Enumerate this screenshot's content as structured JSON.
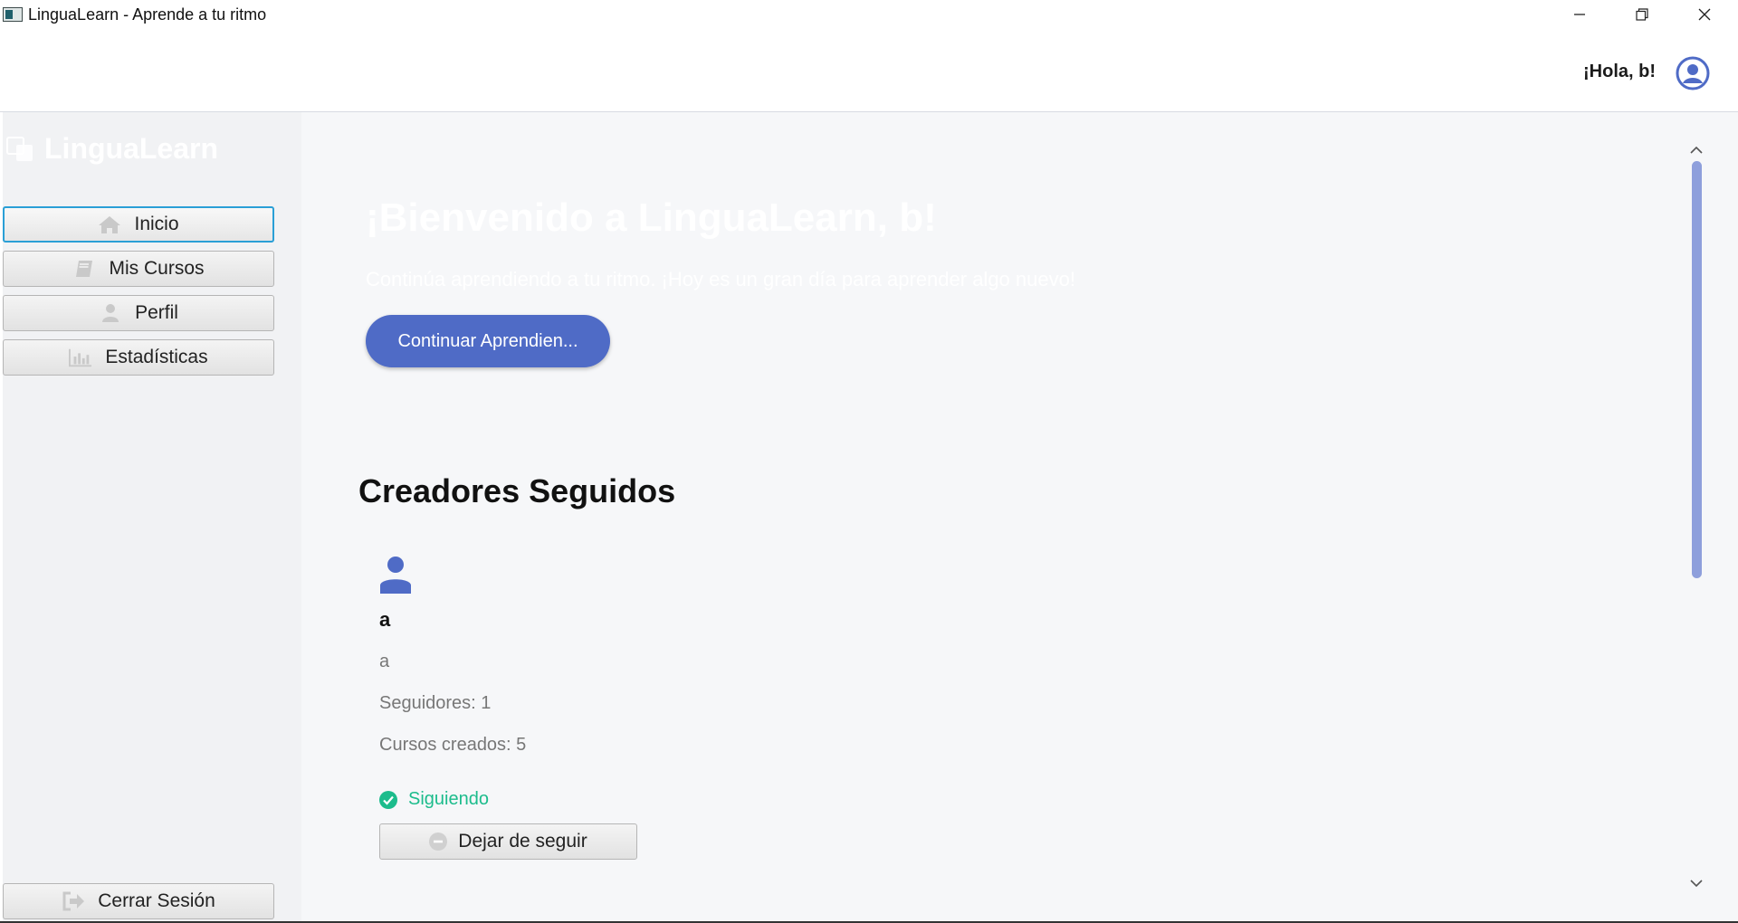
{
  "window": {
    "title": "LinguaLearn - Aprende a tu ritmo",
    "minimize_glyph": "—",
    "maximize_glyph": "❐",
    "close_glyph": "✕"
  },
  "header": {
    "greeting": "¡Hola, b!"
  },
  "sidebar": {
    "brand": "LinguaLearn",
    "items": [
      {
        "label": "Inicio",
        "icon": "home-icon",
        "active": true
      },
      {
        "label": "Mis Cursos",
        "icon": "book-icon"
      },
      {
        "label": "Perfil",
        "icon": "user-icon"
      },
      {
        "label": "Estadísticas",
        "icon": "bar-chart-icon"
      }
    ],
    "logout_label": "Cerrar Sesión"
  },
  "main": {
    "welcome_title": "¡Bienvenido a LinguaLearn, b!",
    "welcome_subtitle": "Continúa aprendiendo a tu ritmo. ¡Hoy es un gran día para aprender algo nuevo!",
    "continue_button": "Continuar Aprendien...",
    "section_title": "Creadores Seguidos",
    "creators": [
      {
        "name": "a",
        "username": "a",
        "followers": "Seguidores: 1",
        "courses": "Cursos creados: 5",
        "status": "Siguiendo",
        "unfollow_label": "Dejar de seguir"
      }
    ]
  },
  "colors": {
    "accent": "#4f6bc6",
    "following": "#1cbc8c",
    "scrollbar": "#8e9fdc",
    "focus_border": "#2a9fd6"
  }
}
